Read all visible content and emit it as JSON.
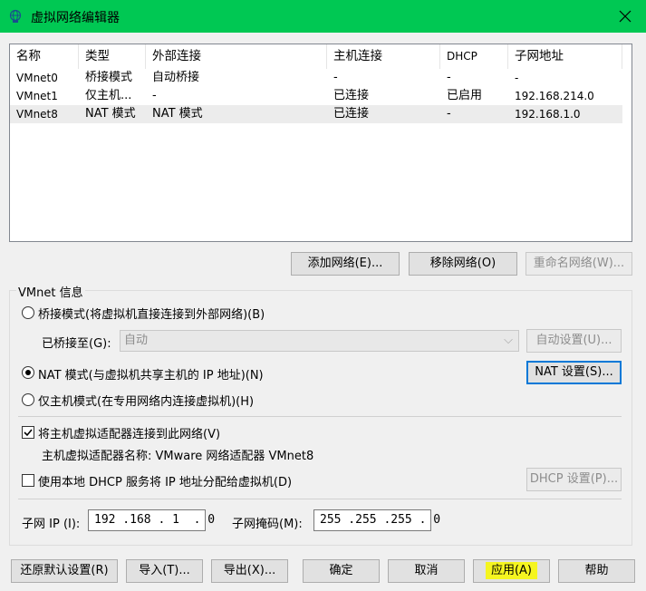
{
  "window": {
    "title": "虚拟网络编辑器",
    "titlebar_color": "#00c853",
    "icon": "network-globe-icon"
  },
  "table": {
    "columns": [
      "名称",
      "类型",
      "外部连接",
      "主机连接",
      "DHCP",
      "子网地址"
    ],
    "rows": [
      [
        "VMnet0",
        "桥接模式",
        "自动桥接",
        "-",
        "-",
        "-"
      ],
      [
        "VMnet1",
        "仅主机...",
        "-",
        "已连接",
        "已启用",
        "192.168.214.0"
      ],
      [
        "VMnet8",
        "NAT 模式",
        "NAT 模式",
        "已连接",
        "-",
        "192.168.1.0"
      ]
    ],
    "selected_row": 2
  },
  "table_buttons": {
    "add": "添加网络(E)...",
    "remove": "移除网络(O)",
    "rename": "重命名网络(W)..."
  },
  "vmnet_info": {
    "group_label": "VMnet 信息",
    "bridged_radio": "桥接模式(将虚拟机直接连接到外部网络)(B)",
    "bridged_to_label": "已桥接至(G):",
    "bridged_to_value": "自动",
    "auto_settings": "自动设置(U)...",
    "nat_radio": "NAT 模式(与虚拟机共享主机的 IP 地址)(N)",
    "nat_settings": "NAT 设置(S)...",
    "host_only_radio": "仅主机模式(在专用网络内连接虚拟机)(H)",
    "connect_adapter_check": "将主机虚拟适配器连接到此网络(V)",
    "adapter_name": "主机虚拟适配器名称: VMware 网络适配器 VMnet8",
    "dhcp_check": "使用本地 DHCP 服务将 IP 地址分配给虚拟机(D)",
    "dhcp_settings": "DHCP 设置(P)...",
    "subnet_ip_label": "子网 IP (I):",
    "subnet_ip_value": "192 .168 . 1  . 0",
    "subnet_mask_label": "子网掩码(M):",
    "subnet_mask_value": "255 .255 .255 . 0",
    "selected_mode": "nat",
    "connect_adapter_checked": true,
    "dhcp_checked": false
  },
  "footer": {
    "restore": "还原默认设置(R)",
    "import": "导入(T)...",
    "export": "导出(X)...",
    "ok": "确定",
    "cancel": "取消",
    "apply": "应用(A)",
    "help": "帮助",
    "highlight_color": "#f5f520"
  }
}
